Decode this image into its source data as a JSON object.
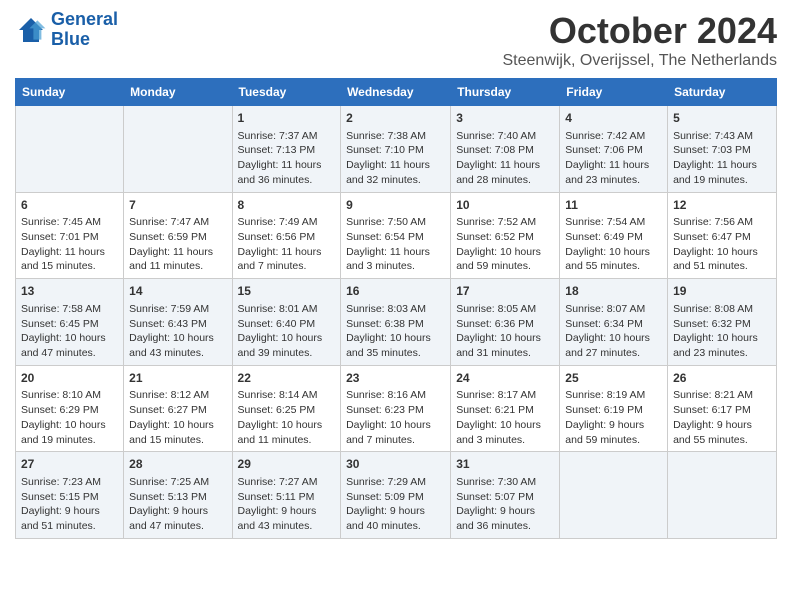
{
  "header": {
    "logo_line1": "General",
    "logo_line2": "Blue",
    "month_title": "October 2024",
    "location": "Steenwijk, Overijssel, The Netherlands"
  },
  "days_of_week": [
    "Sunday",
    "Monday",
    "Tuesday",
    "Wednesday",
    "Thursday",
    "Friday",
    "Saturday"
  ],
  "weeks": [
    [
      {
        "num": "",
        "info": ""
      },
      {
        "num": "",
        "info": ""
      },
      {
        "num": "1",
        "info": "Sunrise: 7:37 AM\nSunset: 7:13 PM\nDaylight: 11 hours and 36 minutes."
      },
      {
        "num": "2",
        "info": "Sunrise: 7:38 AM\nSunset: 7:10 PM\nDaylight: 11 hours and 32 minutes."
      },
      {
        "num": "3",
        "info": "Sunrise: 7:40 AM\nSunset: 7:08 PM\nDaylight: 11 hours and 28 minutes."
      },
      {
        "num": "4",
        "info": "Sunrise: 7:42 AM\nSunset: 7:06 PM\nDaylight: 11 hours and 23 minutes."
      },
      {
        "num": "5",
        "info": "Sunrise: 7:43 AM\nSunset: 7:03 PM\nDaylight: 11 hours and 19 minutes."
      }
    ],
    [
      {
        "num": "6",
        "info": "Sunrise: 7:45 AM\nSunset: 7:01 PM\nDaylight: 11 hours and 15 minutes."
      },
      {
        "num": "7",
        "info": "Sunrise: 7:47 AM\nSunset: 6:59 PM\nDaylight: 11 hours and 11 minutes."
      },
      {
        "num": "8",
        "info": "Sunrise: 7:49 AM\nSunset: 6:56 PM\nDaylight: 11 hours and 7 minutes."
      },
      {
        "num": "9",
        "info": "Sunrise: 7:50 AM\nSunset: 6:54 PM\nDaylight: 11 hours and 3 minutes."
      },
      {
        "num": "10",
        "info": "Sunrise: 7:52 AM\nSunset: 6:52 PM\nDaylight: 10 hours and 59 minutes."
      },
      {
        "num": "11",
        "info": "Sunrise: 7:54 AM\nSunset: 6:49 PM\nDaylight: 10 hours and 55 minutes."
      },
      {
        "num": "12",
        "info": "Sunrise: 7:56 AM\nSunset: 6:47 PM\nDaylight: 10 hours and 51 minutes."
      }
    ],
    [
      {
        "num": "13",
        "info": "Sunrise: 7:58 AM\nSunset: 6:45 PM\nDaylight: 10 hours and 47 minutes."
      },
      {
        "num": "14",
        "info": "Sunrise: 7:59 AM\nSunset: 6:43 PM\nDaylight: 10 hours and 43 minutes."
      },
      {
        "num": "15",
        "info": "Sunrise: 8:01 AM\nSunset: 6:40 PM\nDaylight: 10 hours and 39 minutes."
      },
      {
        "num": "16",
        "info": "Sunrise: 8:03 AM\nSunset: 6:38 PM\nDaylight: 10 hours and 35 minutes."
      },
      {
        "num": "17",
        "info": "Sunrise: 8:05 AM\nSunset: 6:36 PM\nDaylight: 10 hours and 31 minutes."
      },
      {
        "num": "18",
        "info": "Sunrise: 8:07 AM\nSunset: 6:34 PM\nDaylight: 10 hours and 27 minutes."
      },
      {
        "num": "19",
        "info": "Sunrise: 8:08 AM\nSunset: 6:32 PM\nDaylight: 10 hours and 23 minutes."
      }
    ],
    [
      {
        "num": "20",
        "info": "Sunrise: 8:10 AM\nSunset: 6:29 PM\nDaylight: 10 hours and 19 minutes."
      },
      {
        "num": "21",
        "info": "Sunrise: 8:12 AM\nSunset: 6:27 PM\nDaylight: 10 hours and 15 minutes."
      },
      {
        "num": "22",
        "info": "Sunrise: 8:14 AM\nSunset: 6:25 PM\nDaylight: 10 hours and 11 minutes."
      },
      {
        "num": "23",
        "info": "Sunrise: 8:16 AM\nSunset: 6:23 PM\nDaylight: 10 hours and 7 minutes."
      },
      {
        "num": "24",
        "info": "Sunrise: 8:17 AM\nSunset: 6:21 PM\nDaylight: 10 hours and 3 minutes."
      },
      {
        "num": "25",
        "info": "Sunrise: 8:19 AM\nSunset: 6:19 PM\nDaylight: 9 hours and 59 minutes."
      },
      {
        "num": "26",
        "info": "Sunrise: 8:21 AM\nSunset: 6:17 PM\nDaylight: 9 hours and 55 minutes."
      }
    ],
    [
      {
        "num": "27",
        "info": "Sunrise: 7:23 AM\nSunset: 5:15 PM\nDaylight: 9 hours and 51 minutes."
      },
      {
        "num": "28",
        "info": "Sunrise: 7:25 AM\nSunset: 5:13 PM\nDaylight: 9 hours and 47 minutes."
      },
      {
        "num": "29",
        "info": "Sunrise: 7:27 AM\nSunset: 5:11 PM\nDaylight: 9 hours and 43 minutes."
      },
      {
        "num": "30",
        "info": "Sunrise: 7:29 AM\nSunset: 5:09 PM\nDaylight: 9 hours and 40 minutes."
      },
      {
        "num": "31",
        "info": "Sunrise: 7:30 AM\nSunset: 5:07 PM\nDaylight: 9 hours and 36 minutes."
      },
      {
        "num": "",
        "info": ""
      },
      {
        "num": "",
        "info": ""
      }
    ]
  ]
}
